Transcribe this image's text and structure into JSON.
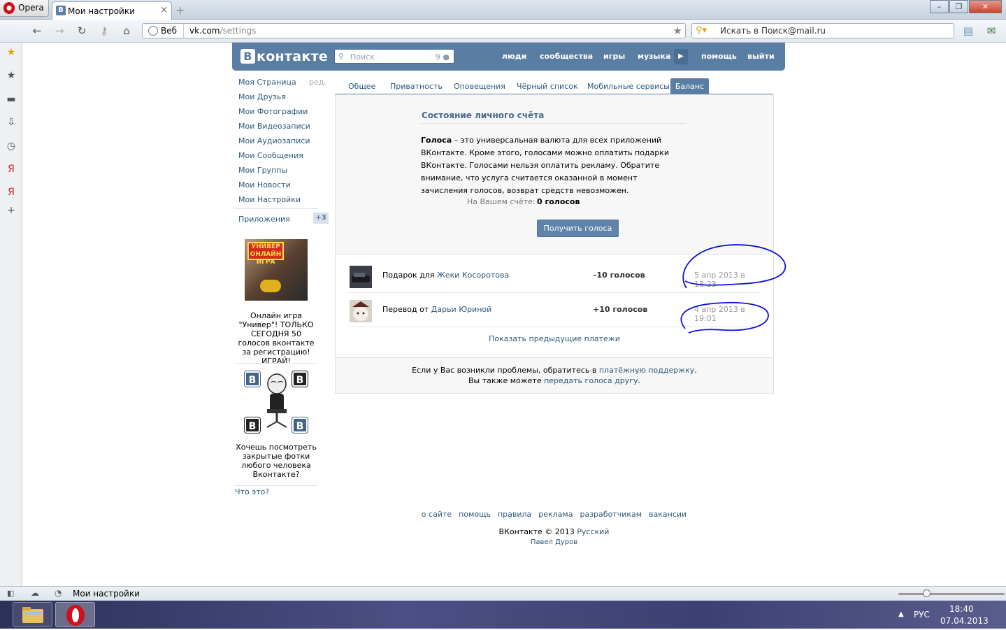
{
  "browser": {
    "app_name": "Opera",
    "tab_title": "Мои настройки",
    "tab_favicon": "В",
    "address_mode": "Веб",
    "url_host": "vk.com",
    "url_path": "/settings",
    "search_placeholder": "Искать в Поиск@mail.ru",
    "status_text": "Мои настройки"
  },
  "vk_header": {
    "logo_letter": "В",
    "logo_text": "контакте",
    "search_placeholder": "Поиск",
    "search_count": "9",
    "nav": [
      "люди",
      "сообщества",
      "игры",
      "музыка",
      "помощь",
      "выйти"
    ]
  },
  "left_menu": {
    "items": [
      "Моя Страница",
      "Мои Друзья",
      "Мои Фотографии",
      "Мои Видеозаписи",
      "Мои Аудиозаписи",
      "Мои Сообщения",
      "Мои Группы",
      "Мои Новости",
      "Мои Настройки"
    ],
    "edit_label": "ред.",
    "apps_label": "Приложения",
    "apps_badge": "+3"
  },
  "ads": {
    "ad1_image_text": "УНИВЕР ОНЛАЙН ИГРА",
    "ad1_text": "Онлайн игра \"Универ\"! ТОЛЬКО СЕГОДНЯ 50 голосов вконтакте за регистрацию! ИГРАЙ!",
    "ad2_badge": "B",
    "ad2_text": "Хочешь посмотреть закрытые фотки любого человека Вконтакте?",
    "what_is_this": "Что это?"
  },
  "settings_tabs": [
    "Общее",
    "Приватность",
    "Оповещения",
    "Чёрный список",
    "Мобильные сервисы",
    "Баланс"
  ],
  "balance": {
    "title": "Состояние личного счёта",
    "desc_bold": "Голоса",
    "desc_rest": " – это универсальная валюта для всех приложений ВКонтакте. Кроме этого, голосами можно оплатить подарки ВКонтакте. Голосами нельзя оплатить рекламу. Обратите внимание, что услуга считается оказанной в момент зачисления голосов, возврат средств невозможен.",
    "account_label": "На Вашем счёте:",
    "account_value": "0 голосов",
    "get_votes_button": "Получить голоса",
    "transactions": [
      {
        "prefix": "Подарок для ",
        "name": "Жеки Косоротова",
        "amount": "–10 голосов",
        "date": "5 апр 2013 в 18:23"
      },
      {
        "prefix": "Перевод от ",
        "name": "Дарьи Юриной",
        "amount": "+10 голосов",
        "date": "4 апр 2013 в 19:01"
      }
    ],
    "show_prev": "Показать предыдущие платежи",
    "foot_line1_a": "Если у Вас возникли проблемы, обратитесь в ",
    "foot_line1_link": "платёжную поддержку",
    "foot_line1_b": ".",
    "foot_line2_a": "Вы также можете ",
    "foot_line2_link": "передать голоса другу",
    "foot_line2_b": "."
  },
  "footer": {
    "links": [
      "о сайте",
      "помощь",
      "правила",
      "реклама",
      "разработчикам",
      "вакансии"
    ],
    "copyright": "ВКонтакте © 2013",
    "language": "Русский",
    "author": "Павел Дуров"
  },
  "taskbar": {
    "lang": "РУС",
    "time": "18:40",
    "date": "07.04.2013"
  },
  "colors": {
    "vk_blue": "#597da3",
    "link": "#2b587a",
    "annotation": "#1010e0"
  }
}
